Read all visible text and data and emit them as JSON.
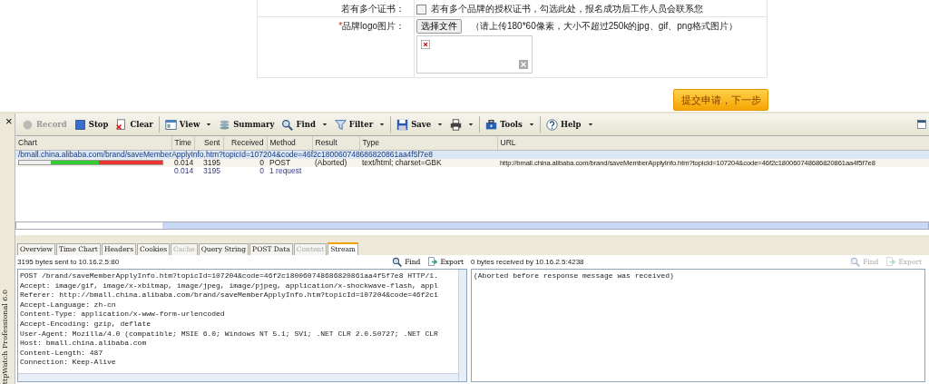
{
  "form": {
    "rows": [
      {
        "kind": "checkbox",
        "label": "若有多个证书：",
        "checked": false,
        "text": "若有多个品牌的授权证书，勾选此处，报名成功后工作人员会联系您"
      },
      {
        "kind": "upload",
        "required_mark": "*",
        "label": "品牌logo图片：",
        "button": "选择文件",
        "hint": "（请上传180*60像素，大小不超过250k的jpg、gif、png格式图片）"
      }
    ],
    "submit": "提交申请，下一步"
  },
  "side": {
    "close": "×",
    "title": "ttpWatch Professional 6.0"
  },
  "toolbar": [
    {
      "label": "Record",
      "dropdown": false,
      "disabled": true
    },
    {
      "label": "Stop",
      "dropdown": false,
      "disabled": false
    },
    {
      "label": "Clear",
      "dropdown": false,
      "disabled": false
    },
    {
      "label": "View",
      "dropdown": true,
      "disabled": false
    },
    {
      "label": "Summary",
      "dropdown": false,
      "disabled": false
    },
    {
      "label": "Find",
      "dropdown": true,
      "disabled": false
    },
    {
      "label": "Filter",
      "dropdown": true,
      "disabled": false
    },
    {
      "label": "Save",
      "dropdown": true,
      "disabled": false
    },
    {
      "dropdown": true,
      "disabled": false
    },
    {
      "label": "Tools",
      "dropdown": true,
      "disabled": false
    },
    {
      "label": "Help",
      "dropdown": true,
      "disabled": false
    }
  ],
  "grid": {
    "columns": [
      "Chart",
      "Time",
      "Sent",
      "Received",
      "Method",
      "Result",
      "Type",
      "URL"
    ],
    "rows": [
      {
        "kind": "page",
        "selected": true,
        "url": "/bmall.china.alibaba.com/brand/saveMemberApplyInfo.htm?topicId=107204&code=46f2c180060748686820861aa4f5f7e8"
      },
      {
        "kind": "request",
        "selected": false,
        "time": "0.014",
        "sent": "3195",
        "received": "0",
        "method": "POST",
        "result": "(Aborted)",
        "type": "text/html; charset=GBK",
        "url": "http://bmall.china.alibaba.com/brand/saveMemberApplyInfo.htm?topicId=107204&code=46f2c180060748686820861aa4f5f7e8"
      },
      {
        "kind": "summary",
        "selected": false,
        "time": "0.014",
        "sent": "3195",
        "received": "0",
        "method": "1 request"
      }
    ]
  },
  "detail_tabs": [
    {
      "label": "Overview",
      "selected": false,
      "disabled": false
    },
    {
      "label": "Time Chart",
      "selected": false,
      "disabled": false
    },
    {
      "label": "Headers",
      "selected": false,
      "disabled": false
    },
    {
      "label": "Cookies",
      "selected": false,
      "disabled": false
    },
    {
      "label": "Cache",
      "selected": false,
      "disabled": true
    },
    {
      "label": "Query String",
      "selected": false,
      "disabled": false
    },
    {
      "label": "POST Data",
      "selected": false,
      "disabled": false
    },
    {
      "label": "Content",
      "selected": false,
      "disabled": true
    },
    {
      "label": "Stream",
      "selected": true,
      "disabled": false
    }
  ],
  "panes": [
    {
      "caption": "3195 bytes sent to 10.16.2.5:80",
      "find": "Find",
      "export": "Export",
      "disabled": false,
      "lines": [
        "POST /brand/saveMemberApplyInfo.htm?topicId=107204&code=46f2c180060748686820861aa4f5f7e8 HTTP/1.",
        "Accept: image/gif, image/x-xbitmap, image/jpeg, image/pjpeg, application/x-shockwave-flash, appl",
        "Referer: http://bmall.china.alibaba.com/brand/saveMemberApplyInfo.htm?topicId=107204&code=46f2c1",
        "Accept-Language: zh-cn",
        "Content-Type: application/x-www-form-urlencoded",
        "Accept-Encoding: gzip, deflate",
        "User-Agent: Mozilla/4.0 (compatible; MSIE 6.0; Windows NT 5.1; SV1; .NET CLR 2.0.50727; .NET CLR",
        "Host: bmall.china.alibaba.com",
        "Content-Length: 487",
        "Connection: Keep-Alive"
      ]
    },
    {
      "caption": "0 bytes received by 10.16.2.5:4238",
      "find": "Find",
      "export": "Export",
      "disabled": true,
      "lines": [
        "(Aborted before response message was received)"
      ]
    }
  ]
}
